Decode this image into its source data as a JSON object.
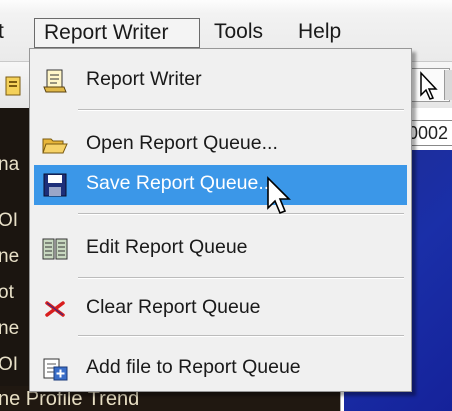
{
  "menubar": {
    "cut_item": "t",
    "report_writer": "Report Writer",
    "tools": "Tools",
    "help": "Help"
  },
  "toolbar": {
    "cursor_icon": "pointer-cursor-icon"
  },
  "background": {
    "left_fragments": [
      "na",
      "OI",
      "ne",
      "ot",
      "ne",
      "OI"
    ],
    "right_field_text": "0002",
    "status_text": "ne Profile Trend"
  },
  "dropdown": {
    "items": [
      {
        "label": "Report Writer",
        "icon": "report-writer-icon"
      },
      {
        "label": "Open Report Queue...",
        "icon": "open-folder-icon"
      },
      {
        "label": "Save Report Queue...",
        "icon": "floppy-disk-icon",
        "highlighted": true
      },
      {
        "label": "Edit Report Queue",
        "icon": "edit-queue-icon"
      },
      {
        "label": "Clear Report Queue",
        "icon": "red-x-icon"
      },
      {
        "label": "Add file to Report Queue",
        "icon": "add-file-icon"
      }
    ]
  },
  "colors": {
    "highlight": "#3b97e8",
    "blue_panel": "#1a2fa8",
    "menu_bg": "#f0f0f0"
  }
}
